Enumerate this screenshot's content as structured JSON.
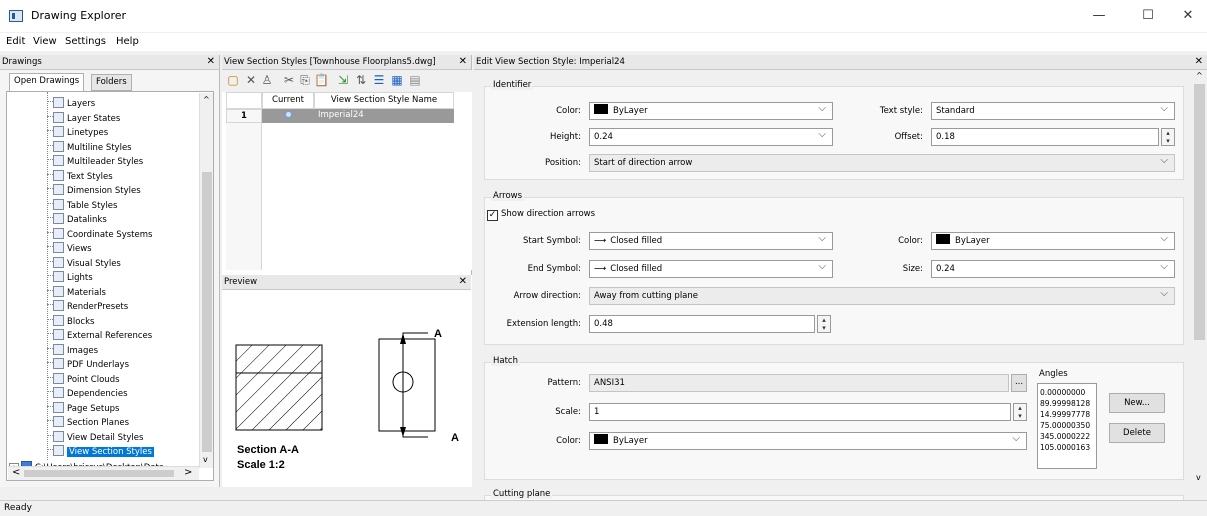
{
  "window": {
    "title": "Drawing Explorer",
    "min": "—",
    "max": "☐",
    "close": "✕"
  },
  "menu": [
    "Edit",
    "View",
    "Settings",
    "Help"
  ],
  "drawings_panel": {
    "header": "Drawings",
    "close": "✕",
    "tabs": [
      "Open Drawings",
      "Folders"
    ],
    "items": [
      "Layers",
      "Layer States",
      "Linetypes",
      "Multiline Styles",
      "Multileader Styles",
      "Text Styles",
      "Dimension Styles",
      "Table Styles",
      "Datalinks",
      "Coordinate Systems",
      "Views",
      "Visual Styles",
      "Lights",
      "Materials",
      "RenderPresets",
      "Blocks",
      "External References",
      "Images",
      "PDF Underlays",
      "Point Clouds",
      "Dependencies",
      "Page Setups",
      "Section Planes",
      "View Detail Styles",
      "View Section Styles"
    ],
    "selected": "View Section Styles",
    "path_item": "C:\\Users\\bricsys\\Desktop\\Data"
  },
  "styles_panel": {
    "header": "View Section Styles [Townhouse Floorplans5.dwg]",
    "close": "✕",
    "columns": [
      "Current",
      "View Section Style Name"
    ],
    "rows": [
      {
        "num": "1",
        "name": "Imperial24"
      }
    ]
  },
  "preview_panel": {
    "header": "Preview",
    "close": "✕",
    "section_label": "Section A-A",
    "scale_label": "Scale 1:2",
    "marker": "A"
  },
  "edit_panel": {
    "header": "Edit View Section Style: Imperial24",
    "close": "✕",
    "identifier": {
      "title": "Identifier",
      "color_label": "Color:",
      "color_value": "ByLayer",
      "textstyle_label": "Text style:",
      "textstyle_value": "Standard",
      "height_label": "Height:",
      "height_value": "0.24",
      "offset_label": "Offset:",
      "offset_value": "0.18",
      "position_label": "Position:",
      "position_value": "Start of direction arrow"
    },
    "arrows": {
      "title": "Arrows",
      "show_label": "Show direction arrows",
      "start_label": "Start Symbol:",
      "start_value": "Closed filled",
      "end_label": "End Symbol:",
      "end_value": "Closed filled",
      "color_label": "Color:",
      "color_value": "ByLayer",
      "size_label": "Size:",
      "size_value": "0.24",
      "direction_label": "Arrow direction:",
      "direction_value": "Away from cutting plane",
      "extension_label": "Extension length:",
      "extension_value": "0.48"
    },
    "hatch": {
      "title": "Hatch",
      "pattern_label": "Pattern:",
      "pattern_value": "ANSI31",
      "scale_label": "Scale:",
      "scale_value": "1",
      "color_label": "Color:",
      "color_value": "ByLayer",
      "angles_label": "Angles",
      "angles": [
        "0.00000000",
        "89.99998128",
        "14.99997778",
        "75.00000350",
        "345.0000222",
        "105.0000163"
      ],
      "new_button": "New...",
      "delete_button": "Delete"
    },
    "cutting_plane": {
      "title": "Cutting plane"
    }
  },
  "status": "Ready"
}
